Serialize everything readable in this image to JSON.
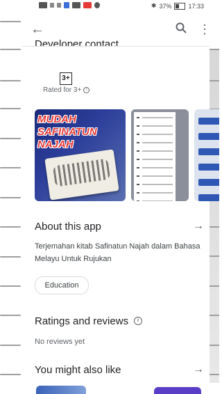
{
  "status_bar": {
    "battery": "37%",
    "time": "17:33"
  },
  "top_section": {
    "cut_heading": "Developer contact",
    "content_rating_badge": "3+",
    "content_rating_text": "Rated for 3+"
  },
  "screenshot1": {
    "title": "MUDAH SAFINATUN NAJAH"
  },
  "about": {
    "title": "About this app",
    "description": "Terjemahan kitab Safinatun Najah dalam Bahasa Melayu Untuk Rujukan",
    "category_chip": "Education"
  },
  "ratings": {
    "title": "Ratings and reviews",
    "empty_text": "No reviews yet"
  },
  "recommend": {
    "title": "You might also like"
  },
  "icons": {
    "back": "←",
    "more": "⋮",
    "arrow": "→",
    "info": "i"
  },
  "colors": {
    "accent": "#202124",
    "muted": "#5f6368",
    "divider": "#e0e0e0",
    "shot_title_red": "#e53935"
  }
}
